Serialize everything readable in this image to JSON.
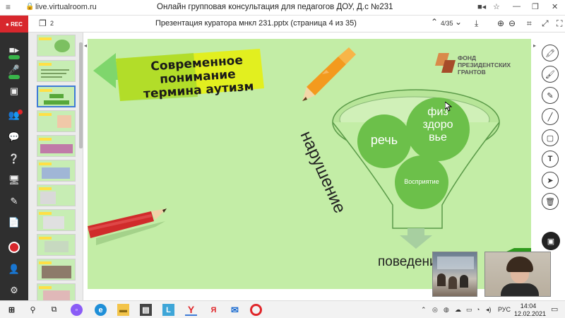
{
  "browser": {
    "url": "live.virtualroom.ru",
    "title": "Онлайн групповая консультация для педагогов ДОУ, Д.с №231"
  },
  "left_toolbar": {
    "rec_label": "● REC"
  },
  "presentation": {
    "counter": "2",
    "title": "Презентация куратора мнкл 231.pptx (страница 4 из 35)",
    "page_indicator": "4/35"
  },
  "slide": {
    "banner_lines": [
      "Современное",
      "понимание",
      "термина  аутизм"
    ],
    "logo_lines": [
      "ФОНД",
      "ПРЕЗИДЕНТСКИХ",
      "ГРАНТОВ"
    ],
    "rotated_word": "нарушение",
    "circle_speech": "речь",
    "circle_health_lines": [
      "физ",
      "здоро",
      "вье"
    ],
    "circle_perception": "Восприятие",
    "bottom_word": "поведение"
  },
  "taskbar": {
    "lang": "РУС",
    "time": "14:04",
    "date": "12.02.2021"
  },
  "colors": {
    "slide_bg": "#c3eda6",
    "circle_green": "#6cc04a",
    "toolbar_dark": "#2f2f2f",
    "rec_red": "#d8272d"
  }
}
